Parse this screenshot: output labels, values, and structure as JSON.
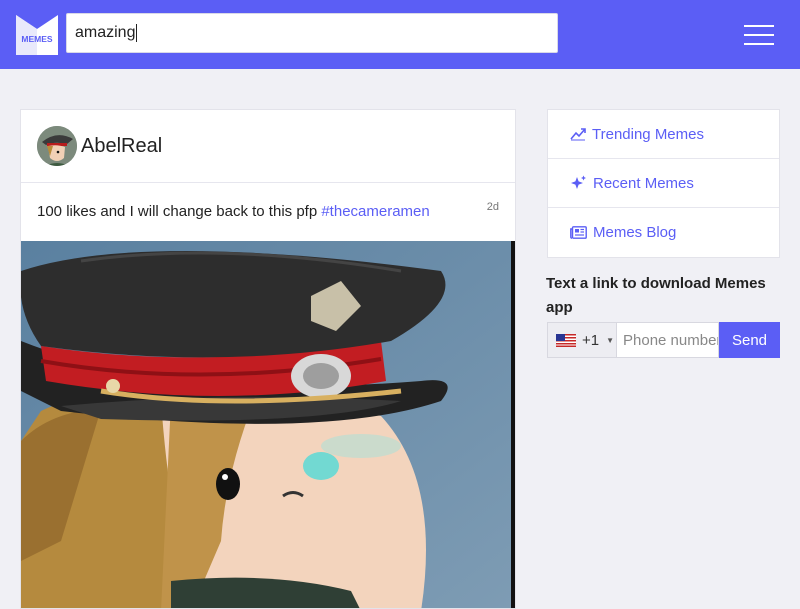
{
  "header": {
    "logo_text": "MEMES",
    "search_value": "amazing",
    "brand_color": "#5b5ef5",
    "menu_icon": "hamburger-icon"
  },
  "post": {
    "username": "AbelReal",
    "caption": "100 likes and I will change back to this pfp",
    "hashtag": "#thecameramen",
    "time_ago": "2d",
    "avatar_icon": "user-avatar",
    "image_icon": "meme-image"
  },
  "sidebar": {
    "items": [
      {
        "label": "Trending Memes",
        "icon": "trending-icon"
      },
      {
        "label": "Recent Memes",
        "icon": "sparkle-icon"
      },
      {
        "label": "Memes Blog",
        "icon": "newspaper-icon"
      }
    ]
  },
  "download": {
    "text": "Text a link to download Memes app",
    "country_code": "+1",
    "country_flag": "us-flag-icon",
    "phone_placeholder": "Phone number",
    "send_label": "Send"
  }
}
